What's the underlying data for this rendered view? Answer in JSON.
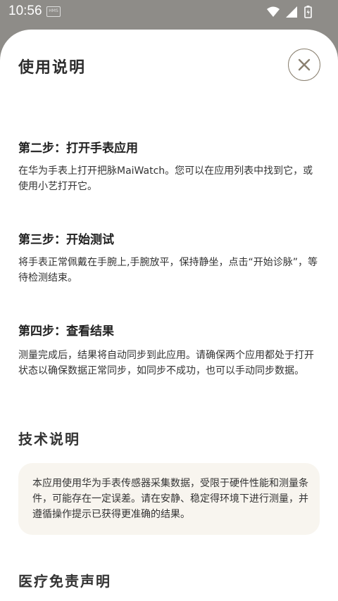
{
  "status_bar": {
    "time": "10:56",
    "badge": "HMS",
    "icons": [
      "wifi-icon",
      "signal-icon",
      "battery-icon"
    ]
  },
  "sheet": {
    "title": "使用说明",
    "close_icon": "close-icon"
  },
  "steps": [
    {
      "title": "第二步：打开手表应用",
      "body": "在华为手表上打开把脉MaiWatch。您可以在应用列表中找到它，或使用小艺打开它。"
    },
    {
      "title": "第三步：开始测试",
      "body": "将手表正常佩戴在手腕上,手腕放平，保持静坐，点击“开始诊脉”，等待检测结束。"
    },
    {
      "title": "第四步：查看结果",
      "body": "测量完成后，结果将自动同步到此应用。请确保两个应用都处于打开状态以确保数据正常同步，如同步不成功，也可以手动同步数据。"
    }
  ],
  "tech": {
    "title": "技术说明",
    "body": "本应用使用华为手表传感器采集数据，受限于硬件性能和测量条件，可能存在一定误差。请在安静、稳定得环境下进行测量，并遵循操作提示已获得更准确的结果。"
  },
  "disclaimer": {
    "title": "医疗免责声明"
  },
  "colors": {
    "backdrop": "#8e8c88",
    "sheet": "#ffffff",
    "card": "#f8f5ef",
    "close_border": "#8a8070"
  }
}
